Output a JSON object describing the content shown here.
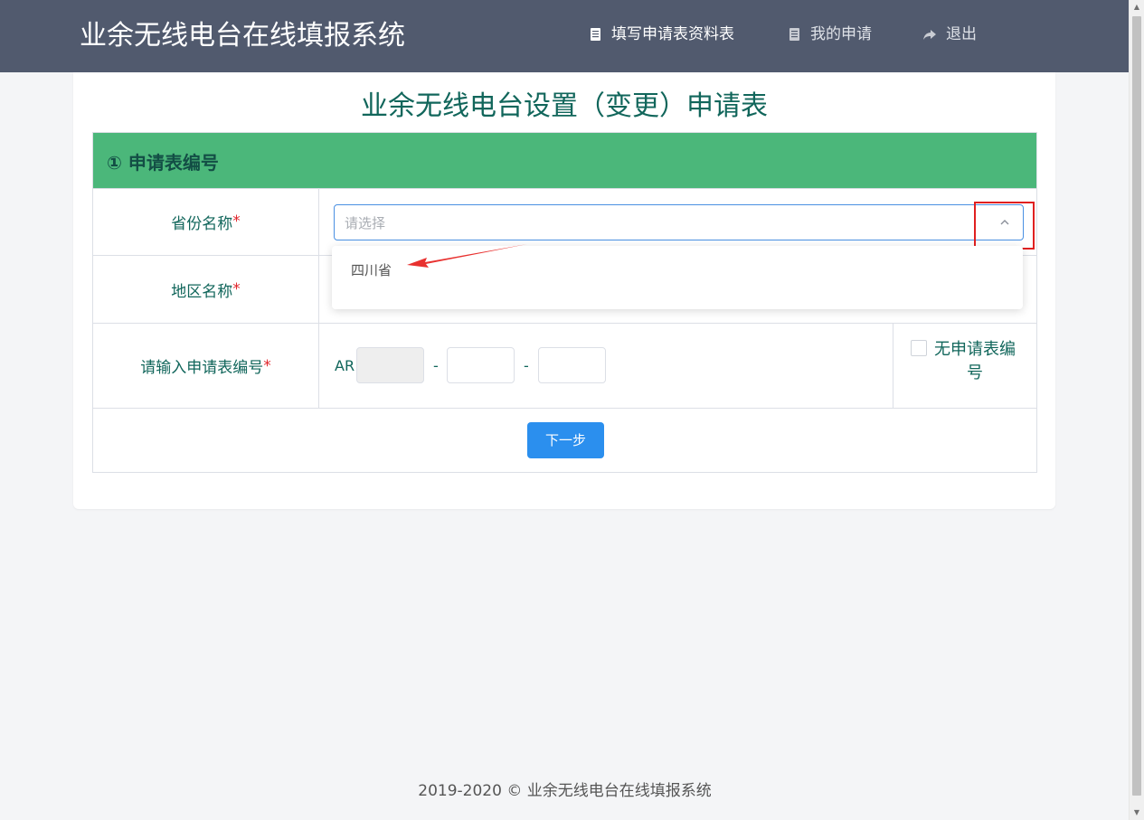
{
  "header": {
    "brand": "业余无线电台在线填报系统",
    "nav": [
      {
        "label": "填写申请表资料表",
        "icon": "document-icon"
      },
      {
        "label": "我的申请",
        "icon": "document-icon"
      },
      {
        "label": "退出",
        "icon": "share-arrow-icon"
      }
    ]
  },
  "form": {
    "title": "业余无线电台设置（变更）申请表",
    "section_title": "① 申请表编号",
    "province": {
      "label": "省份名称",
      "required_mark": "*",
      "placeholder": "请选择",
      "options": [
        "四川省"
      ]
    },
    "region": {
      "label": "地区名称",
      "required_mark": "*"
    },
    "number": {
      "label": "请输入申请表编号",
      "required_mark": "*",
      "prefix": "AR",
      "separator": "-",
      "no_number_label": "无申请表编号"
    },
    "next_button": "下一步"
  },
  "footer": {
    "text": "2019-2020 © 业余无线电台在线填报系统"
  },
  "colors": {
    "header_bg": "#515a6e",
    "section_bg": "#4bb77a",
    "label_text": "#11665b",
    "primary_button": "#2b8fee",
    "required": "#e0252b",
    "highlight": "#e02020"
  }
}
